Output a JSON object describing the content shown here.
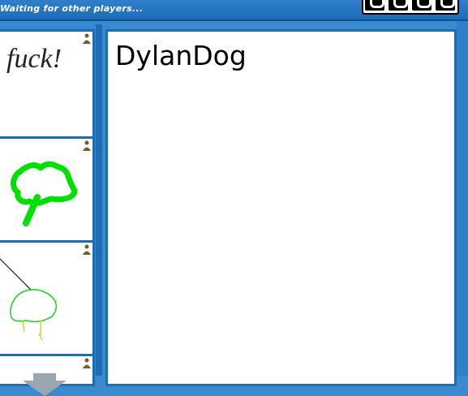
{
  "status": {
    "text": "Waiting for other players..."
  },
  "timer": {
    "icon": "timer-digits-icon"
  },
  "thumbnails": [
    {
      "name": "thumb-1",
      "label": "fuck!",
      "icon": "player-icon"
    },
    {
      "name": "thumb-2",
      "icon": "player-icon"
    },
    {
      "name": "thumb-3",
      "icon": "player-icon"
    },
    {
      "name": "thumb-4",
      "icon": "player-icon"
    }
  ],
  "drawing": {
    "text": "DylanDog"
  },
  "colors": {
    "frame_blue": "#1f6cb6",
    "panel_blue": "#3a8ad0",
    "green_scribble": "#00dd00",
    "lime_scribble": "#22cc22",
    "player_brown": "#7a5a2a"
  }
}
